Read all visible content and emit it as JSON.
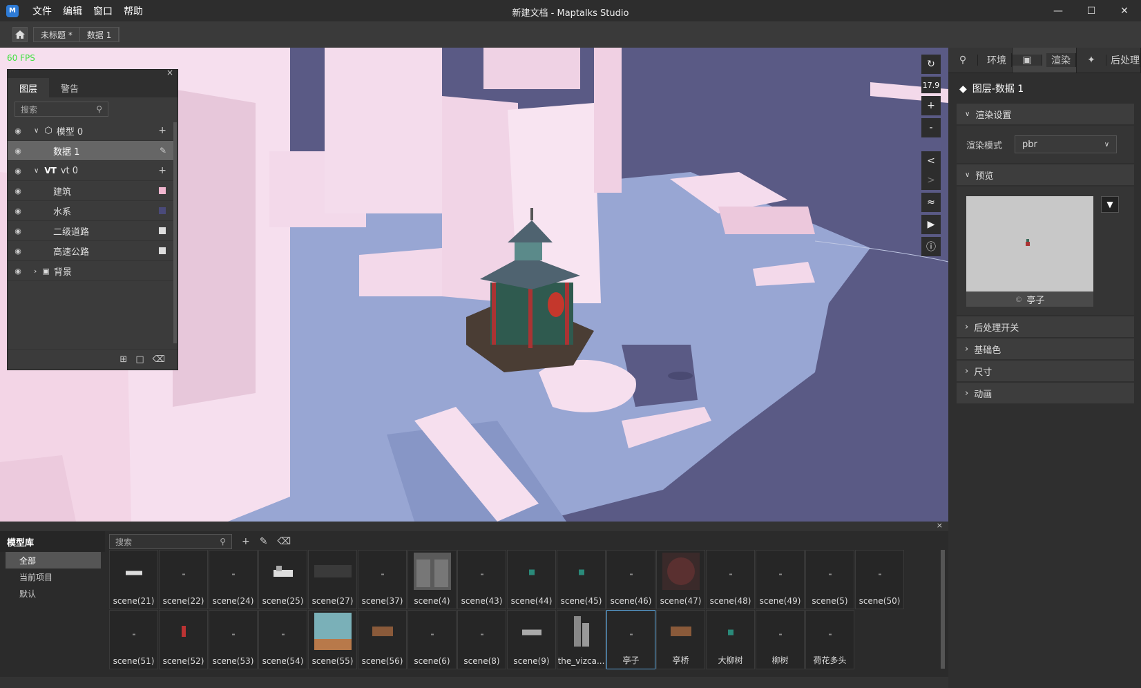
{
  "app": {
    "title": "新建文档 - Maptalks Studio",
    "logo": "M"
  },
  "menu": [
    "文件",
    "编辑",
    "窗口",
    "帮助"
  ],
  "doc_tabs": [
    "未标题 *",
    "数据 1"
  ],
  "viewport": {
    "fps": "60 FPS",
    "zoom": "17.9"
  },
  "layer_panel": {
    "tabs": [
      "图层",
      "警告"
    ],
    "search_placeholder": "搜索",
    "rows": [
      {
        "name": "模型 0",
        "type": "group"
      },
      {
        "name": "数据 1",
        "type": "selected"
      },
      {
        "name": "vt 0",
        "prefix": "VT",
        "type": "group"
      },
      {
        "name": "建筑",
        "color": "#f0b6cf"
      },
      {
        "name": "水系",
        "color": "#4a4a7a"
      },
      {
        "name": "二级道路",
        "color": "#dddddd"
      },
      {
        "name": "高速公路",
        "color": "#dddddd"
      },
      {
        "name": "背景",
        "type": "group"
      }
    ]
  },
  "right_panel": {
    "tabs": [
      "环境",
      "渲染",
      "后处理"
    ],
    "layer_title": "图层-数据 1",
    "render_settings": "渲染设置",
    "render_mode_label": "渲染模式",
    "render_mode_value": "pbr",
    "preview": "预览",
    "preview_name": "亭子",
    "sections": [
      "后处理开关",
      "基础色",
      "尺寸",
      "动画"
    ]
  },
  "library": {
    "title": "模型库",
    "categories": [
      "全部",
      "当前项目",
      "默认"
    ],
    "search_placeholder": "搜索",
    "items": [
      "scene(21)",
      "scene(22)",
      "scene(24)",
      "scene(25)",
      "scene(27)",
      "scene(37)",
      "scene(4)",
      "scene(43)",
      "scene(44)",
      "scene(45)",
      "scene(46)",
      "scene(47)",
      "scene(48)",
      "scene(49)",
      "scene(5)",
      "scene(50)",
      "scene(51)",
      "scene(52)",
      "scene(53)",
      "scene(54)",
      "scene(55)",
      "scene(56)",
      "scene(6)",
      "scene(8)",
      "scene(9)",
      "the_vizca...",
      "亭子",
      "亭桥",
      "大柳树",
      "柳树",
      "荷花多头"
    ]
  }
}
